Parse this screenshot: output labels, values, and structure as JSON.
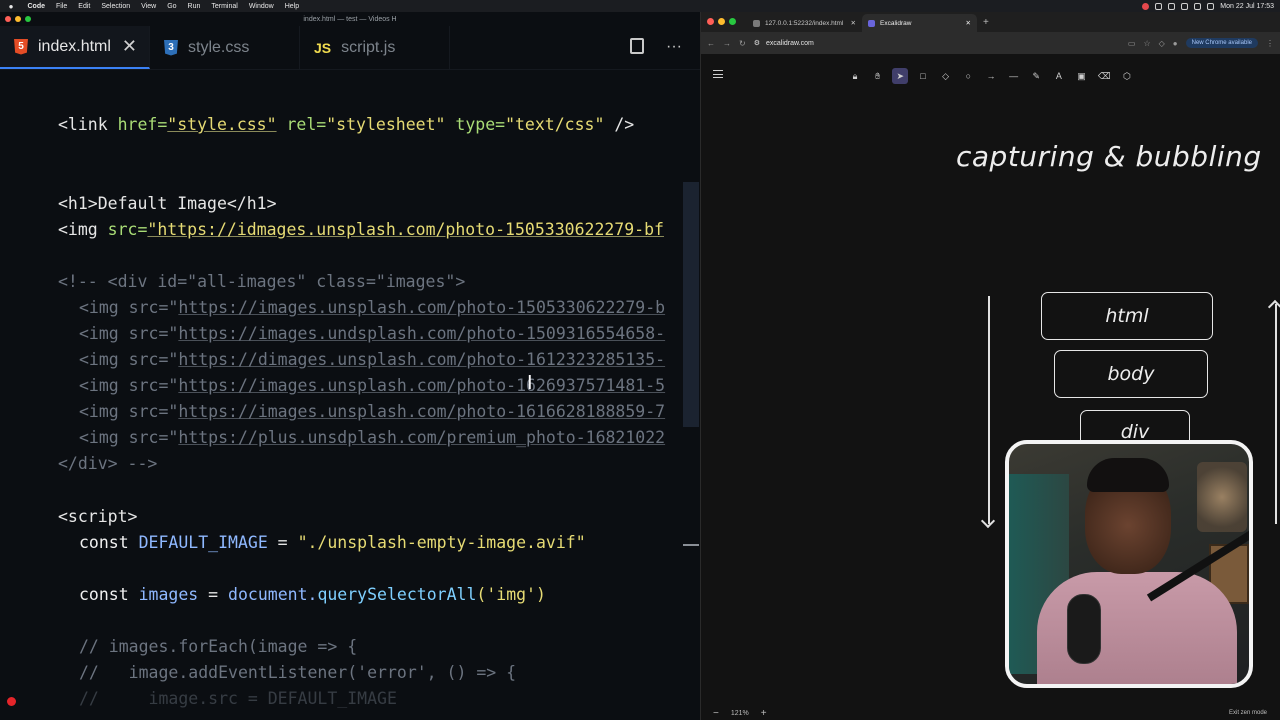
{
  "menubar": {
    "apple": "",
    "items": [
      "Code",
      "File",
      "Edit",
      "Selection",
      "View",
      "Go",
      "Run",
      "Terminal",
      "Window",
      "Help"
    ],
    "clock": "Mon 22 Jul 17:53"
  },
  "editor": {
    "window_title": "index.html — test — Videos H",
    "tabs": [
      {
        "label": "index.html",
        "icon": "html5-icon",
        "glyph": "5",
        "active": true
      },
      {
        "label": "style.css",
        "icon": "css3-icon",
        "glyph": "3"
      },
      {
        "label": "script.js",
        "icon": "js-icon",
        "glyph": "JS"
      }
    ],
    "close_glyph": "✕",
    "more_glyph": "···",
    "code": {
      "l1": {
        "open": "<link ",
        "a1": "href=",
        "v1": "\"style.css\"",
        "a2": " rel=",
        "v2": "\"stylesheet\"",
        "a3": " type=",
        "v3": "\"text/css\"",
        "close": " />"
      },
      "l2": "<h1>Default Image</h1>",
      "l3": {
        "open": "<img ",
        "a1": "src=",
        "v1": "\"https://idmages.unsplash.com/photo-1505330622279-bf"
      },
      "l4": "<!-- <div id=\"all-images\" class=\"images\">",
      "imgs": [
        {
          "pre": "<img src=\"",
          "url": "https://images.unsplash.com/photo-1505330622279-b"
        },
        {
          "pre": "<img src=\"",
          "url": "https://images.undsplash.com/photo-1509316554658-"
        },
        {
          "pre": "<img src=\"",
          "url": "https://dimages.unsplash.com/photo-1612323285135-"
        },
        {
          "pre": "<img src=\"",
          "url": "https://images.unsplash.com/photo-1626937571481-5"
        },
        {
          "pre": "<img src=\"",
          "url": "https://images.unsplash.com/photo-1616628188859-7"
        },
        {
          "pre": "<img src=\"",
          "url": "https://plus.unsdplash.com/premium_photo-16821022"
        }
      ],
      "l5": "</div> -->",
      "l6": "<script>",
      "l7": {
        "kw": "const ",
        "name": "DEFAULT_IMAGE",
        "eq": " = ",
        "val": "\"./unsplash-empty-image.avif\""
      },
      "l8": {
        "kw": "const ",
        "name": "images",
        "eq": " = ",
        "obj": "document.",
        "fn": "querySelectorAll",
        "args": "('img')"
      },
      "l9": "// images.forEach(image => {",
      "l10": "//   image.addEventListener('error', () => {",
      "l11": "//     image.src = DEFAULT_IMAGE"
    }
  },
  "browser": {
    "tabs": [
      {
        "label": "127.0.0.1:52232/index.html",
        "close": "✕"
      },
      {
        "label": "Excalidraw",
        "close": "✕",
        "active": true
      }
    ],
    "newtab": "+",
    "url": "excalidraw.com",
    "update_label": "New Chrome available",
    "canvas": {
      "title": "capturing & bubbling",
      "boxes": [
        "html",
        "body",
        "div"
      ],
      "zoom_level": "121%",
      "zoom_minus": "−",
      "zoom_plus": "+",
      "exit_zen": "Exit zen mode"
    }
  },
  "colors": {
    "accent": "#3b82f6",
    "excalidraw_active": "#403e6a",
    "record": "#e5252a"
  }
}
